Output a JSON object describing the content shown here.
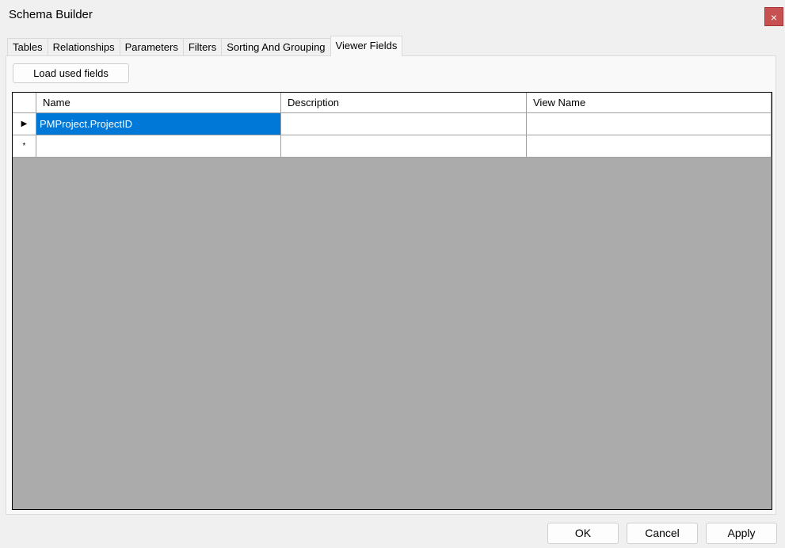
{
  "window": {
    "title": "Schema Builder",
    "close_glyph": "×"
  },
  "tabs": [
    {
      "label": "Tables"
    },
    {
      "label": "Relationships"
    },
    {
      "label": "Parameters"
    },
    {
      "label": "Filters"
    },
    {
      "label": "Sorting And Grouping"
    },
    {
      "label": "Viewer Fields",
      "active": true
    }
  ],
  "toolbar": {
    "load_label": "Load used fields"
  },
  "grid": {
    "columns": [
      "Name",
      "Description",
      "View Name"
    ],
    "rows": [
      {
        "indicator": "▶",
        "cells": [
          "PMProject.ProjectID",
          "",
          ""
        ],
        "selected": true
      },
      {
        "indicator": "*",
        "cells": [
          "",
          "",
          ""
        ],
        "selected": false
      }
    ],
    "selection_color": "#0078d7"
  },
  "footer": {
    "ok_label": "OK",
    "cancel_label": "Cancel",
    "apply_label": "Apply"
  }
}
